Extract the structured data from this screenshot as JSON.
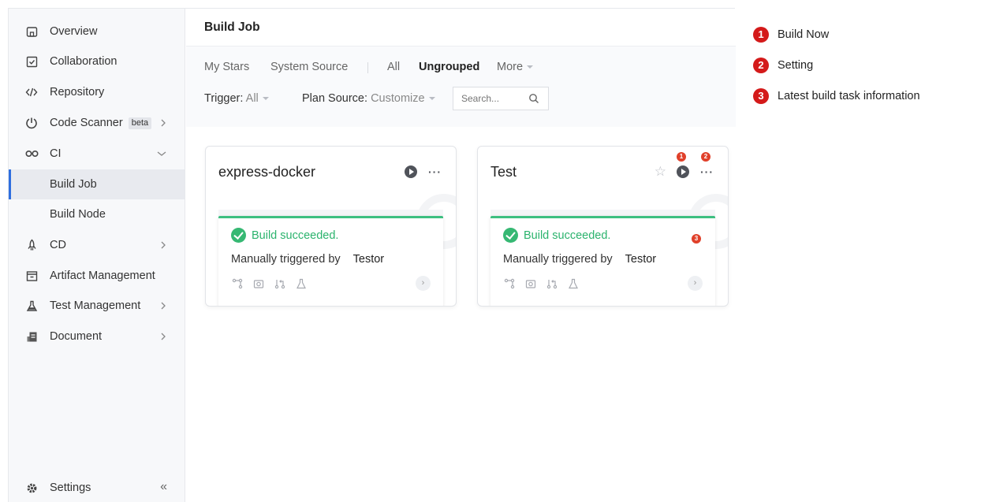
{
  "sidebar": {
    "items": [
      {
        "label": "Overview",
        "icon": "home-icon"
      },
      {
        "label": "Collaboration",
        "icon": "collaboration-icon"
      },
      {
        "label": "Repository",
        "icon": "code-icon"
      },
      {
        "label": "Code Scanner",
        "icon": "scanner-icon",
        "badge": "beta"
      },
      {
        "label": "CI",
        "icon": "infinity-icon"
      },
      {
        "label": "Build Job"
      },
      {
        "label": "Build Node"
      },
      {
        "label": "CD",
        "icon": "rocket-icon"
      },
      {
        "label": "Artifact Management",
        "icon": "artifact-icon"
      },
      {
        "label": "Test Management",
        "icon": "flask-icon"
      },
      {
        "label": "Document",
        "icon": "document-icon"
      }
    ],
    "active": "Build Job",
    "settings_label": "Settings",
    "collapse_symbol": "«"
  },
  "header": {
    "title": "Build Job"
  },
  "tabs": [
    {
      "label": "My Stars",
      "active": false
    },
    {
      "label": "System Source",
      "active": false
    },
    {
      "label": "All",
      "active": false
    },
    {
      "label": "Ungrouped",
      "active": true
    },
    {
      "label": "More",
      "active": false
    }
  ],
  "filters": {
    "trigger_label": "Trigger:",
    "trigger_value": "All",
    "plan_source_label": "Plan Source:",
    "plan_source_value": "Customize",
    "search_placeholder": "Search..."
  },
  "cards": [
    {
      "name": "express-docker",
      "status": "Build succeeded.",
      "trigger_text": "Manually triggered by",
      "triggered_by": "Testor",
      "starred_visible": false
    },
    {
      "name": "Test",
      "status": "Build succeeded.",
      "trigger_text": "Manually triggered by",
      "triggered_by": "Testor",
      "starred_visible": true
    }
  ],
  "markers": [
    "1",
    "2",
    "3"
  ],
  "legend": [
    {
      "num": "1",
      "label": "Build Now"
    },
    {
      "num": "2",
      "label": "Setting"
    },
    {
      "num": "3",
      "label": "Latest build task information"
    }
  ],
  "colors": {
    "accent": "#2f6fdf",
    "success": "#2bb36d",
    "marker": "#e0402a"
  }
}
